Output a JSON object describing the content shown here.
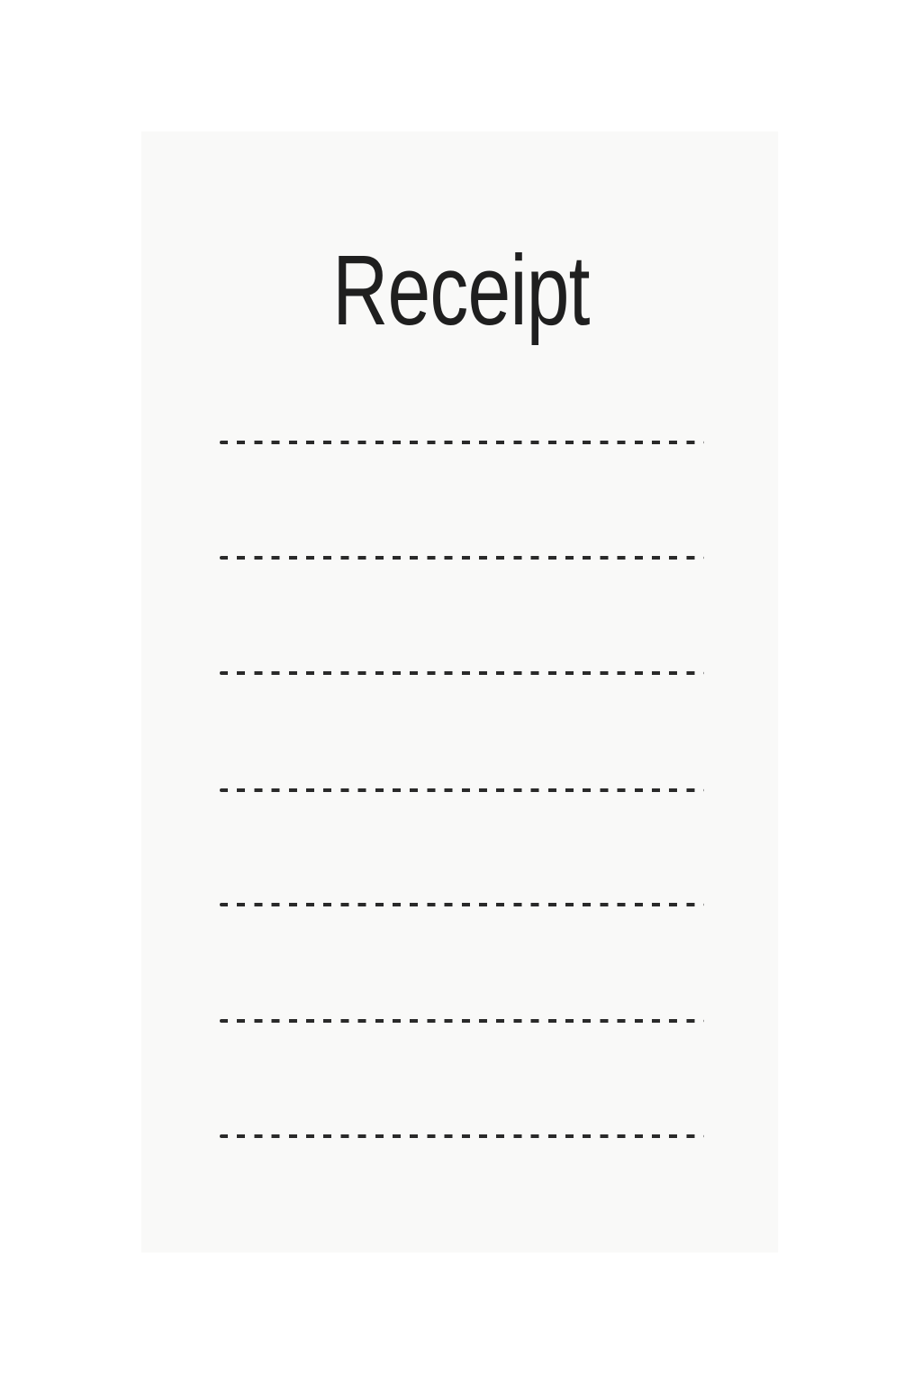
{
  "receipt": {
    "title": "Receipt",
    "lines": [
      {
        "text": ""
      },
      {
        "text": ""
      },
      {
        "text": ""
      },
      {
        "text": ""
      },
      {
        "text": ""
      },
      {
        "text": ""
      },
      {
        "text": ""
      }
    ]
  }
}
